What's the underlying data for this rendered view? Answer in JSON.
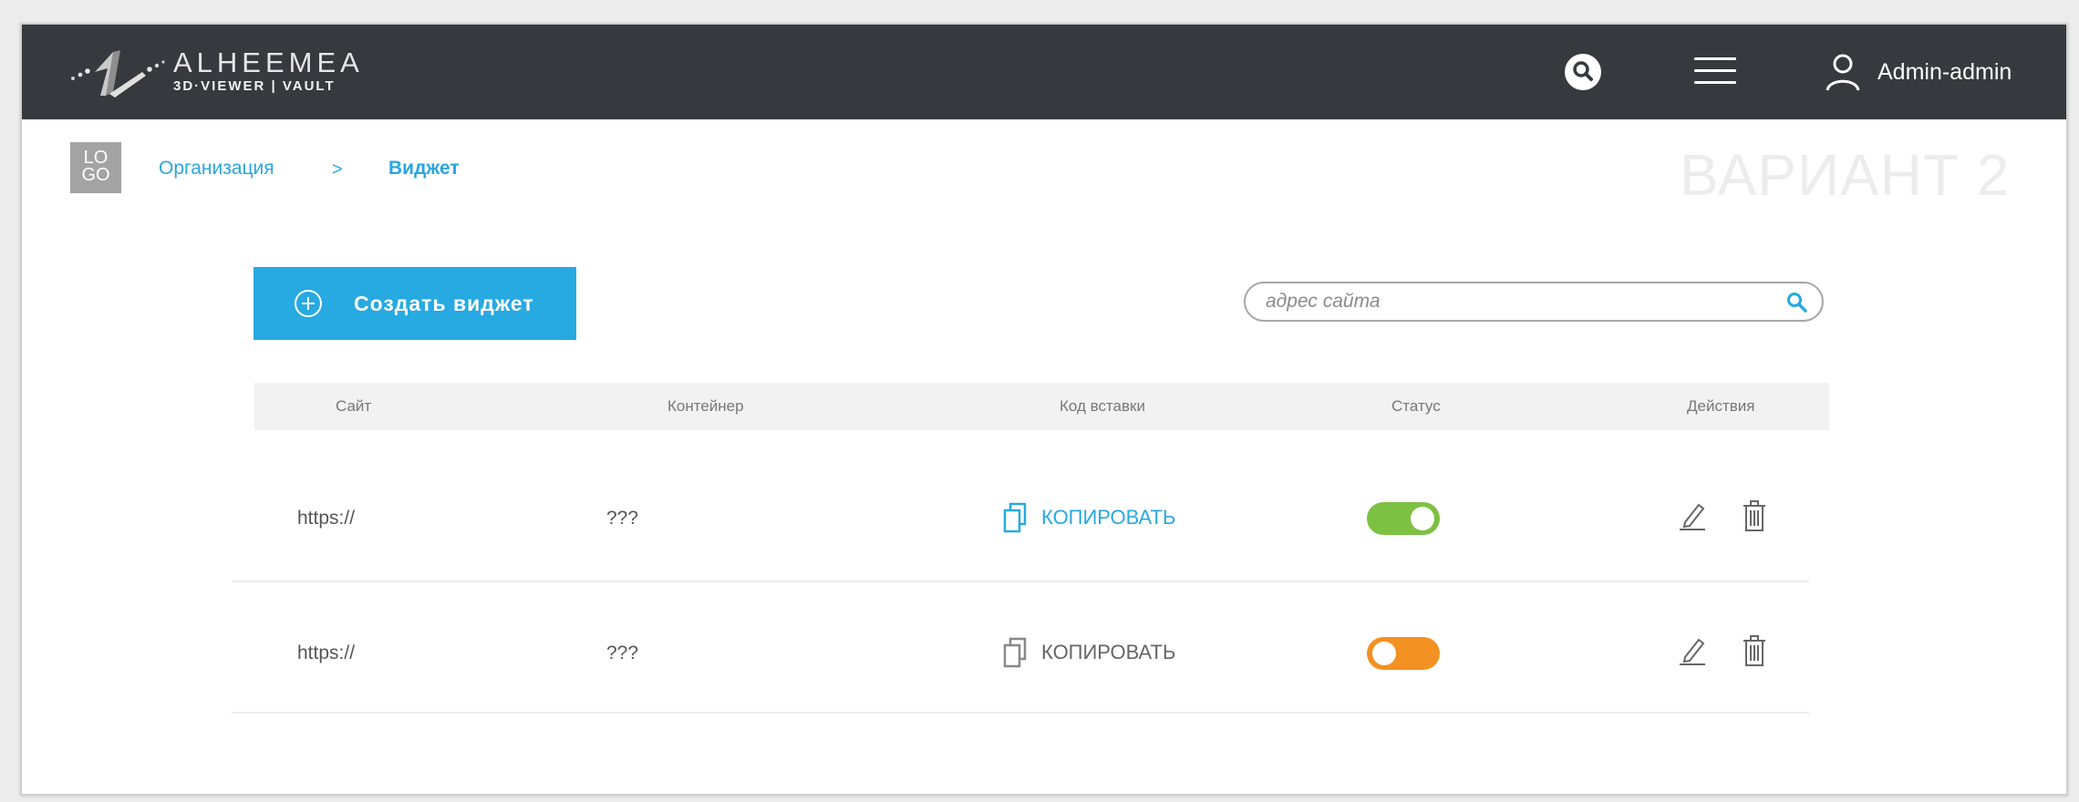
{
  "header": {
    "brand_name": "ALHEEMEA",
    "brand_sub": "3D·VIEWER | VAULT",
    "user_name": "Admin-admin"
  },
  "breadcrumb": {
    "logo_text_1": "LO",
    "logo_text_2": "GO",
    "items": [
      "Организация",
      "Виджет"
    ],
    "separator": ">"
  },
  "variant_label": "ВАРИАНТ 2",
  "toolbar": {
    "create_label": "Создать виджет",
    "search_placeholder": "адрес сайта",
    "search_value": ""
  },
  "table": {
    "columns": [
      "Сайт",
      "Контейнер",
      "Код вставки",
      "Статус",
      "Действия"
    ],
    "rows": [
      {
        "site": "https://",
        "container": "???",
        "copy_label": "КОПИРОВАТЬ",
        "copy_active": true,
        "status": "on"
      },
      {
        "site": "https://",
        "container": "???",
        "copy_label": "КОПИРОВАТЬ",
        "copy_active": false,
        "status": "off"
      }
    ]
  },
  "colors": {
    "header_bg": "#36393d",
    "accent": "#27a9e1",
    "link": "#2aa6e0",
    "status_on": "#7dc142",
    "status_off": "#f39122",
    "copy_inactive": "#666666"
  },
  "icons": {
    "header_search": "search-icon",
    "menu": "hamburger-menu-icon",
    "user": "user-icon",
    "create": "plus-circle-icon",
    "field_search": "search-icon",
    "copy": "copy-icon",
    "edit": "pencil-icon",
    "delete": "trash-icon"
  }
}
